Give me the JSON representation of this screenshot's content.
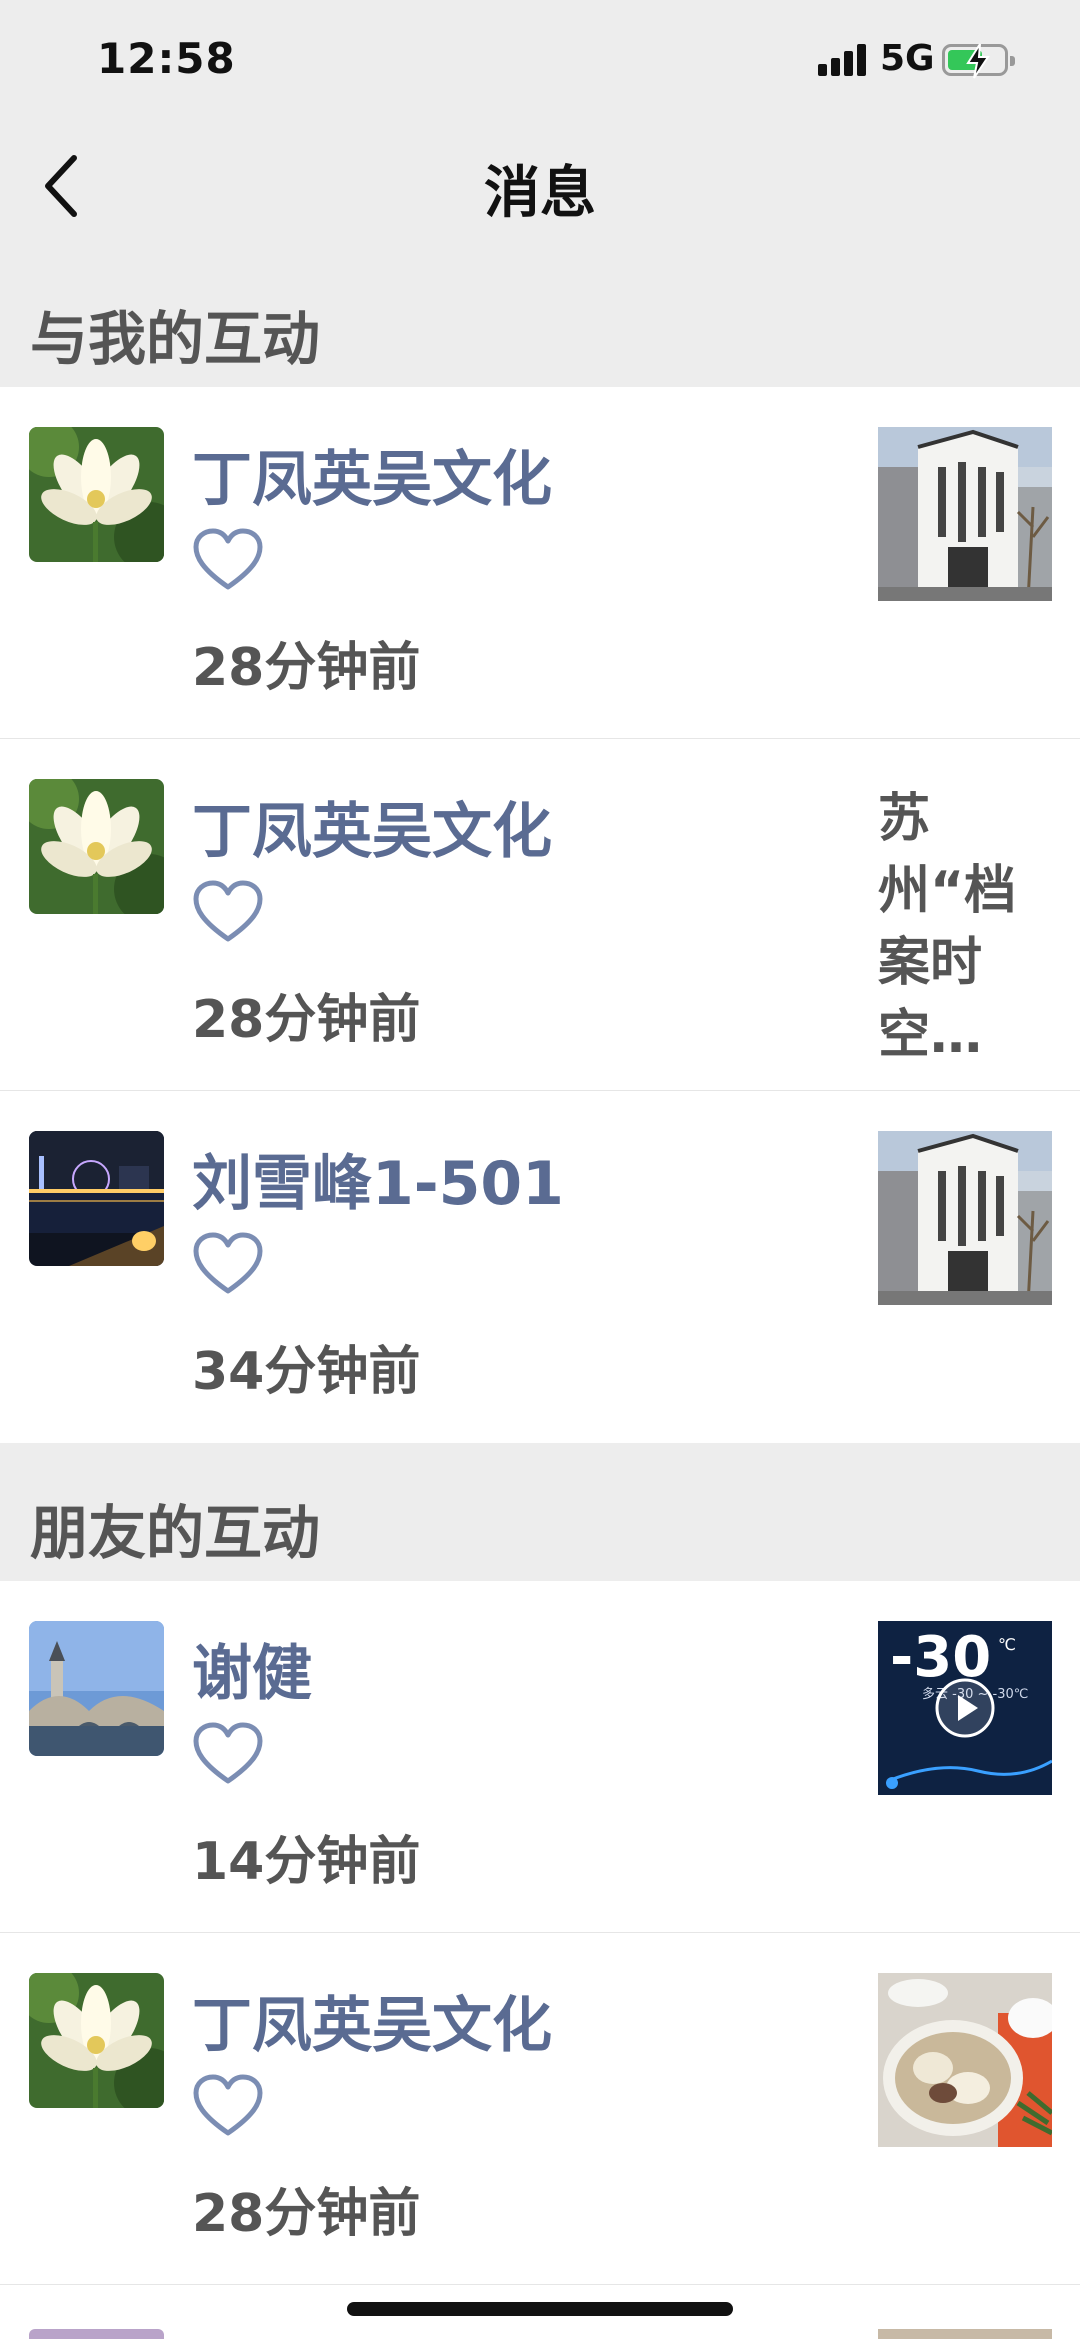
{
  "status_bar": {
    "time": "12:58",
    "network": "5G"
  },
  "nav": {
    "title": "消息"
  },
  "sections": [
    {
      "title": "与我的互动"
    },
    {
      "title": "朋友的互动"
    }
  ],
  "items": [
    {
      "name": "丁凤英吴文化",
      "time": "28分钟前",
      "thumb": "building-photo"
    },
    {
      "name": "丁凤英吴文化",
      "time": "28分钟前",
      "snippet": "苏州“档案时空…"
    },
    {
      "name": "刘雪峰1-501",
      "time": "34分钟前",
      "thumb": "building-photo"
    },
    {
      "name": "谢健",
      "time": "14分钟前",
      "thumb": "video-thumbnail",
      "thumb_text": "-30",
      "thumb_unit": "℃",
      "thumb_sub": "多云 -30 ~ -30℃"
    },
    {
      "name": "丁凤英吴文化",
      "time": "28分钟前",
      "thumb": "food-photo"
    }
  ],
  "icons": {
    "back": "chevron-left-icon",
    "like": "heart-icon"
  },
  "colors": {
    "name": "#5a6b92",
    "heart": "#7b8db3",
    "background": "#ededed"
  }
}
